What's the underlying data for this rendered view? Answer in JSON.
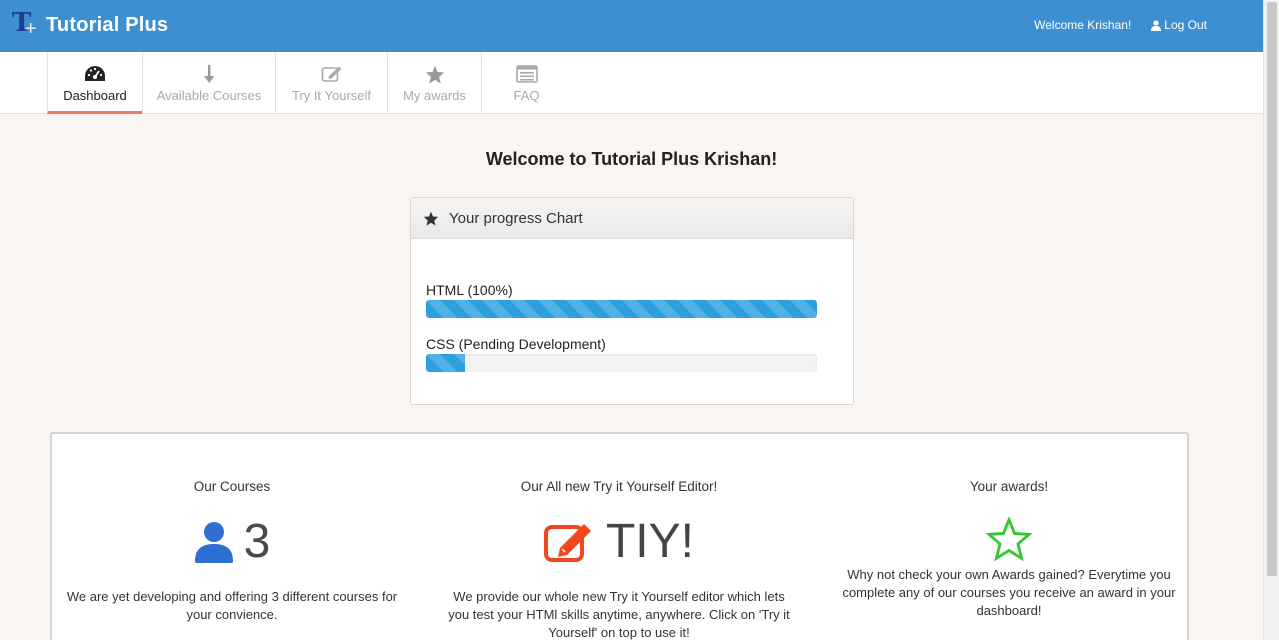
{
  "brand": {
    "name": "Tutorial Plus",
    "logo_text": "T",
    "logo_sub": "+"
  },
  "topnav": {
    "welcome": "Welcome Krishan!",
    "logout": "Log Out"
  },
  "tabs": [
    {
      "label": "Dashboard",
      "icon": "dashboard-icon",
      "active": true
    },
    {
      "label": "Available Courses",
      "icon": "download-arrow-icon"
    },
    {
      "label": "Try It Yourself",
      "icon": "edit-icon"
    },
    {
      "label": "My awards",
      "icon": "star-icon"
    },
    {
      "label": "FAQ",
      "icon": "list-icon"
    }
  ],
  "welcome": "Welcome to Tutorial Plus Krishan!",
  "progress": {
    "title": "Your progress Chart",
    "items": [
      {
        "label": "HTML (100%)",
        "value": 100
      },
      {
        "label": "CSS (Pending Development)",
        "value": 10
      }
    ]
  },
  "features": {
    "courses": {
      "title": "Our Courses",
      "number": "3",
      "desc": "We are yet developing and offering 3 different courses for your convience."
    },
    "tiy": {
      "title": "Our All new Try it Yourself Editor!",
      "big": "TIY!",
      "desc": "We provide our whole new Try it Yourself editor which lets you test your HTMl skills anytime, anywhere. Click on 'Try it Yourself' on top to use it!"
    },
    "awards": {
      "title": "Your awards!",
      "desc": "Why not check your own Awards gained? Everytime you complete any of our courses you receive an award in your dashboard!"
    }
  },
  "colors": {
    "navbar": "#3d8fd1",
    "active_tab_underline": "#f07b6b",
    "progress_fill": "#2b9fe0",
    "user_icon": "#2f6fd2",
    "edit_icon": "#f0471f",
    "award_icon": "#33c733"
  }
}
